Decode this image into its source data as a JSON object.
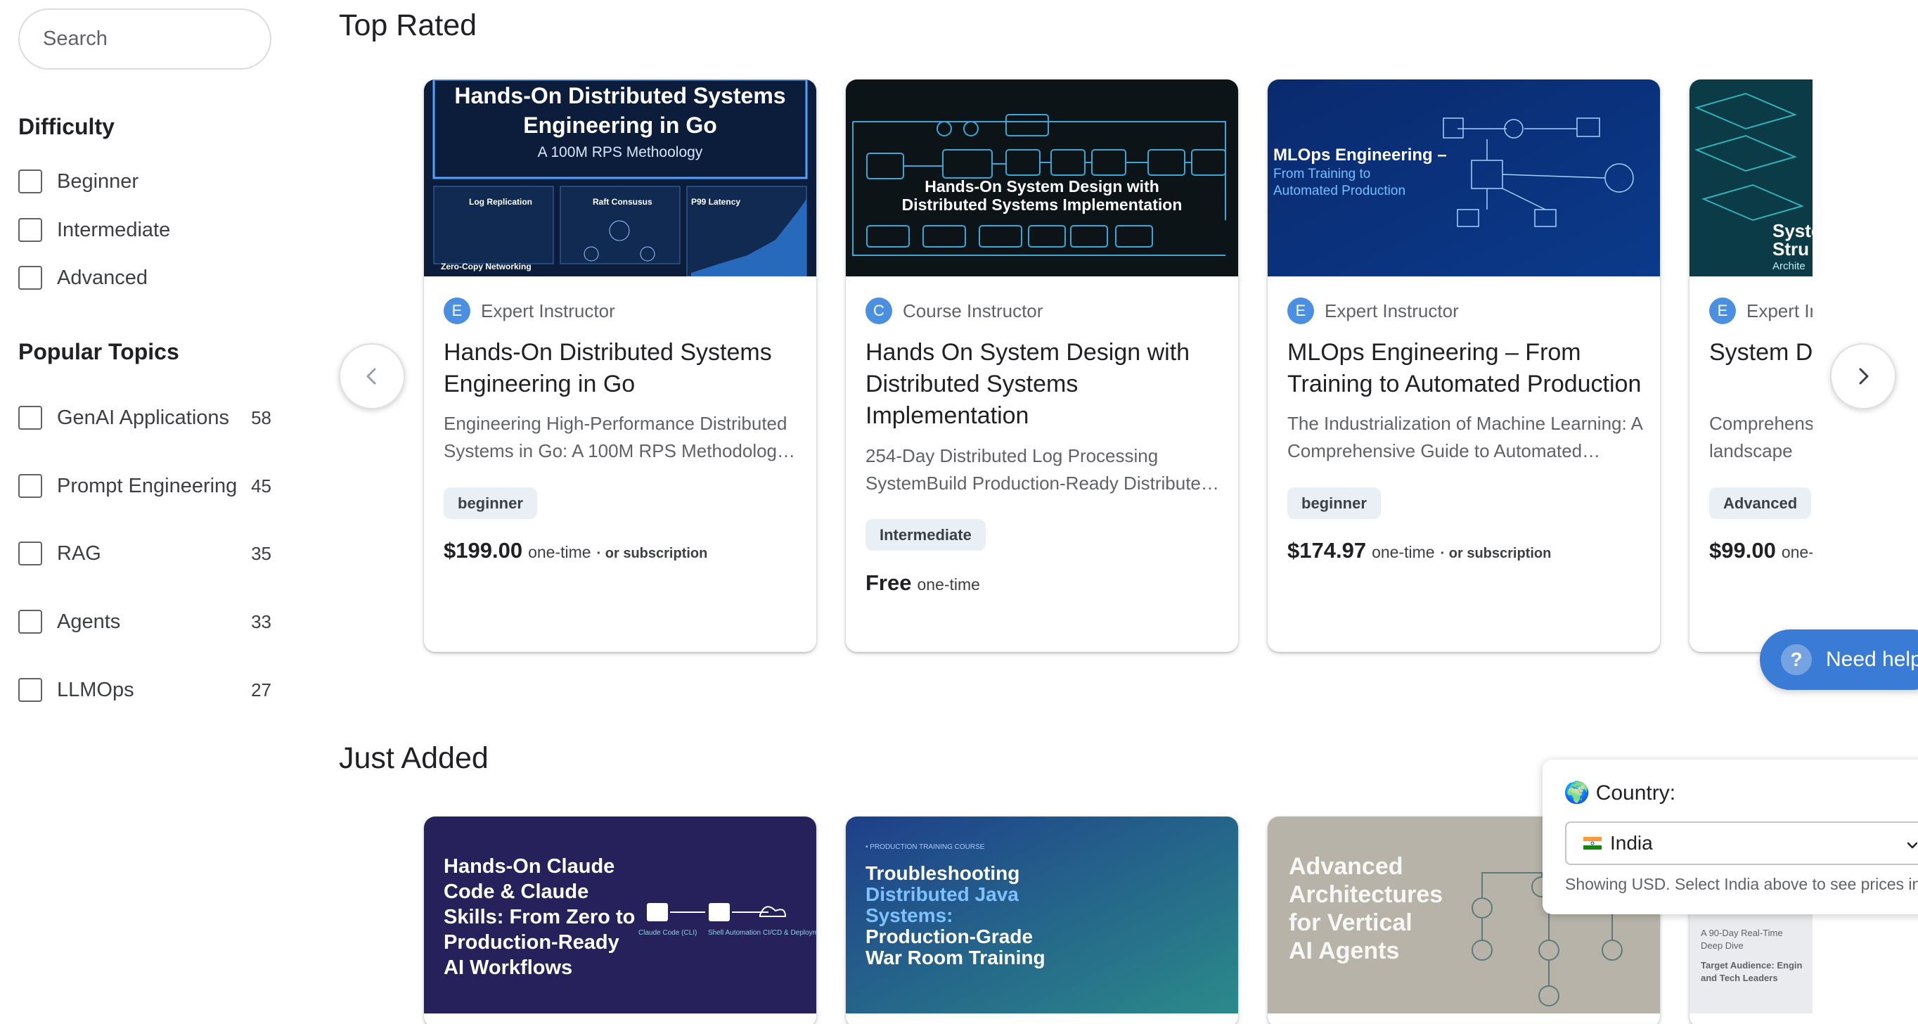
{
  "sidebar": {
    "search_placeholder": "Search",
    "difficulty": {
      "heading": "Difficulty",
      "options": [
        {
          "label": "Beginner"
        },
        {
          "label": "Intermediate"
        },
        {
          "label": "Advanced"
        }
      ]
    },
    "topics": {
      "heading": "Popular Topics",
      "options": [
        {
          "label": "GenAI Applications",
          "count": "58"
        },
        {
          "label": "Prompt Engineering",
          "count": "45"
        },
        {
          "label": "RAG",
          "count": "35"
        },
        {
          "label": "Agents",
          "count": "33"
        },
        {
          "label": "LLMOps",
          "count": "27"
        }
      ]
    }
  },
  "top_rated": {
    "title": "Top Rated",
    "cards": [
      {
        "thumb": {
          "title_line1": "Hands-On Distributed Systems",
          "title_line2": "Engineering in Go",
          "subtitle": "A 100M RPS Methoology",
          "panel1": "Log Replication",
          "panel2": "Raft Consusus",
          "panel3": "P99 Latency",
          "footer": "Zero-Copy Networking"
        },
        "avatar": "E",
        "instructor": "Expert Instructor",
        "title": "Hands-On Distributed Systems Engineering in Go",
        "description": "Engineering High-Performance Distributed Systems in Go: A 100M RPS Methodology and Production Patterns",
        "level": "beginner",
        "price": "$199.00",
        "price_type": "one-time",
        "price_sub": "· or subscription"
      },
      {
        "thumb": {
          "line1": "Hands-On System Design with",
          "line2": "Distributed Systems Implementation"
        },
        "avatar": "C",
        "instructor": "Course Instructor",
        "title": "Hands On System Design with Distributed Systems Implementation",
        "description": "254-Day Distributed Log Processing SystemBuild Production-Ready Distributed Systems from scratch",
        "level": "Intermediate",
        "price": "Free",
        "price_type": "one-time",
        "price_sub": ""
      },
      {
        "thumb": {
          "line1": "MLOps Engineering –",
          "line2": "From Training to",
          "line3": "Automated Production"
        },
        "avatar": "E",
        "instructor": "Expert Instructor",
        "title": "MLOps Engineering – From Training to Automated Production",
        "description": "The Industrialization of Machine Learning: A Comprehensive Guide to Automated Production Pipelines",
        "level": "beginner",
        "price": "$174.97",
        "price_type": "one-time",
        "price_sub": "· or subscription"
      },
      {
        "thumb": {
          "line1": "Syste",
          "line2": "Stru",
          "line3": "Archite"
        },
        "avatar": "E",
        "instructor": "Expert Instructor",
        "title": "System Design & Data Structures",
        "description": "Comprehensive guide to the Competitive landscape",
        "level": "Advanced",
        "price": "$99.00",
        "price_type": "one-time",
        "price_sub": ""
      }
    ]
  },
  "just_added": {
    "title": "Just Added",
    "cards": [
      {
        "thumb": {
          "l1": "Hands-On Claude",
          "l2": "Code & Claude",
          "l3": "Skills: From Zero to",
          "l4": "Production-Ready",
          "l5": "AI Workflows",
          "s1": "Claude Code (CLI)",
          "s2": "Shell Automation",
          "s3": "CI/CD & Deployment"
        }
      },
      {
        "thumb": {
          "kicker": "• PRODUCTION TRAINING COURSE",
          "l1": "Troubleshooting",
          "l2": "Distributed Java",
          "l3": "Systems:",
          "l4": "Production-Grade",
          "l5": "War Room Training"
        }
      },
      {
        "thumb": {
          "l1": "Advanced",
          "l2": "Architectures",
          "l3": "for Vertical",
          "l4": "AI Agents"
        }
      },
      {
        "thumb": {
          "l1": "A 90-Day Real-Time",
          "l2": "Deep Dive",
          "l3": "Target Audience: Engin",
          "l4": "and Tech Leaders"
        }
      }
    ]
  },
  "help": {
    "label": "Need help?"
  },
  "country": {
    "label": "🌍 Country:",
    "selected": "India",
    "note": "Showing USD. Select India above to see prices in ₹"
  },
  "colors": {
    "accent": "#3a7bd5",
    "avatar": "#4a8fe0",
    "badge_bg": "#e8f0f6"
  }
}
